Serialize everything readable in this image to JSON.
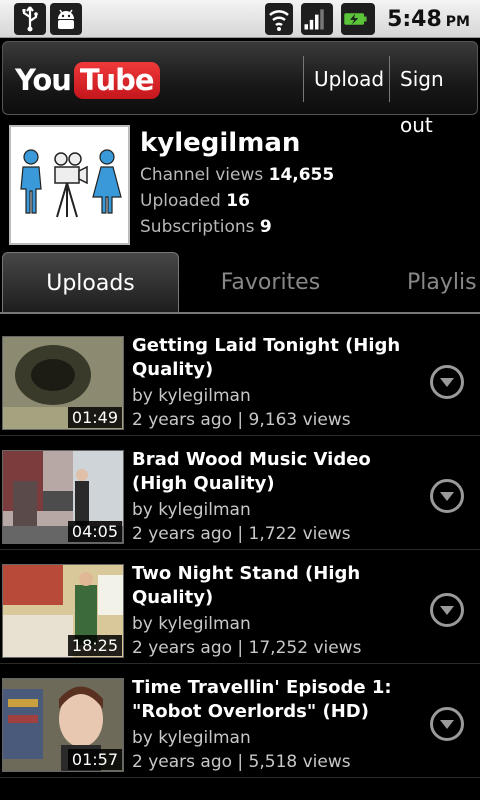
{
  "status_bar": {
    "time": "5:48",
    "ampm": "PM",
    "icons": [
      "usb-icon",
      "android-debug-icon",
      "wifi-icon",
      "signal-icon",
      "battery-charging-icon"
    ]
  },
  "header": {
    "logo_you": "You",
    "logo_tube": "Tube",
    "upload_label": "Upload",
    "signout_label": "Sign out"
  },
  "profile": {
    "username": "kylegilman",
    "channel_views_label": "Channel views",
    "channel_views": "14,655",
    "uploaded_label": "Uploaded",
    "uploaded": "16",
    "subscriptions_label": "Subscriptions",
    "subscriptions": "9"
  },
  "tabs": [
    {
      "label": "Uploads"
    },
    {
      "label": "Favorites"
    },
    {
      "label": "Playlis"
    }
  ],
  "videos": [
    {
      "title": "Getting Laid Tonight (High Quality)",
      "by": "by kylegilman",
      "meta": "2 years ago | 9,163 views",
      "duration": "01:49"
    },
    {
      "title": "Brad Wood Music Video (High Quality)",
      "by": "by kylegilman",
      "meta": "2 years ago | 1,722 views",
      "duration": "04:05"
    },
    {
      "title": "Two Night Stand (High Quality)",
      "by": "by kylegilman",
      "meta": "2 years ago | 17,252 views",
      "duration": "18:25"
    },
    {
      "title": "Time Travellin' Episode 1: \"Robot Overlords\" (HD)",
      "by": "by kylegilman",
      "meta": "2 years ago | 5,518 views",
      "duration": "01:57"
    }
  ]
}
